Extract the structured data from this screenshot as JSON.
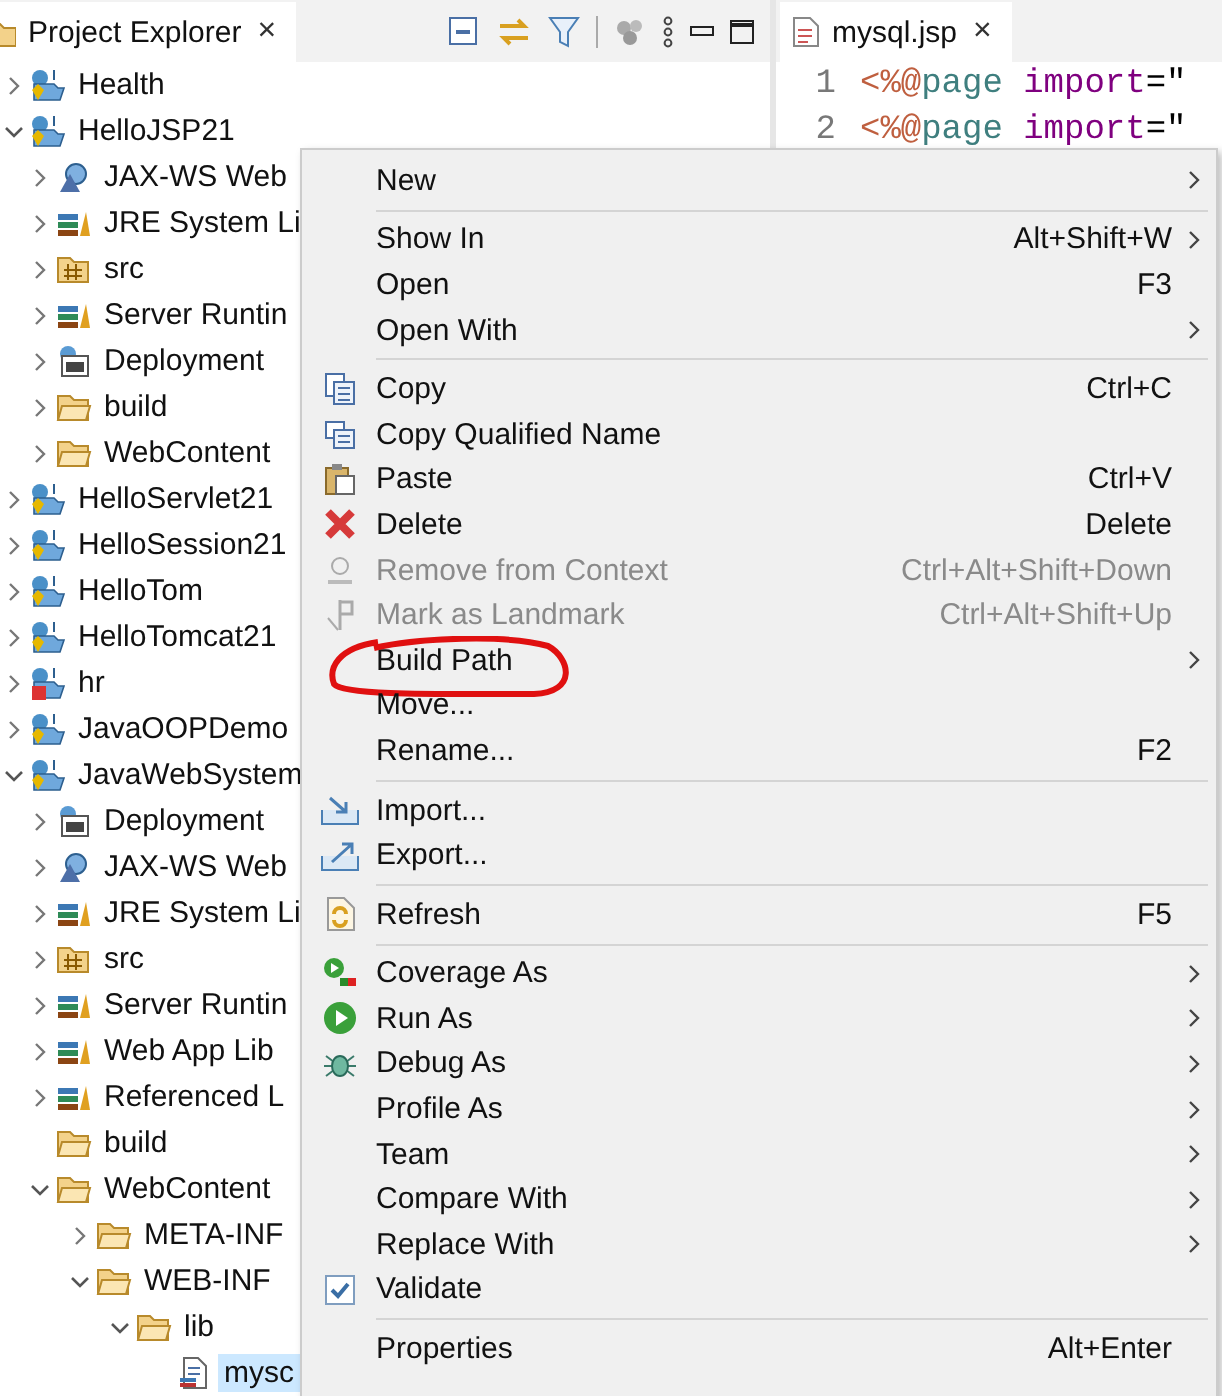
{
  "explorer": {
    "title": "Project Explorer",
    "close": "×"
  },
  "tree": [
    {
      "label": "Health",
      "kind": "project",
      "expanded": false
    },
    {
      "label": "HelloJSP21",
      "kind": "project",
      "expanded": true,
      "children": [
        {
          "label": "JAX-WS Web",
          "kind": "webservice",
          "expanded": false
        },
        {
          "label": "JRE System Li",
          "kind": "library",
          "expanded": false
        },
        {
          "label": "src",
          "kind": "source",
          "expanded": false
        },
        {
          "label": "Server Runtin",
          "kind": "library",
          "expanded": false
        },
        {
          "label": "Deployment",
          "kind": "deployment",
          "expanded": false
        },
        {
          "label": "build",
          "kind": "folder",
          "expanded": false
        },
        {
          "label": "WebContent",
          "kind": "folder",
          "expanded": false
        }
      ]
    },
    {
      "label": "HelloServlet21",
      "kind": "project",
      "expanded": false
    },
    {
      "label": "HelloSession21",
      "kind": "project",
      "expanded": false
    },
    {
      "label": "HelloTom",
      "kind": "project",
      "expanded": false
    },
    {
      "label": "HelloTomcat21",
      "kind": "project",
      "expanded": false
    },
    {
      "label": "hr",
      "kind": "project-error",
      "expanded": false
    },
    {
      "label": "JavaOOPDemo",
      "kind": "project",
      "expanded": false
    },
    {
      "label": "JavaWebSystem",
      "kind": "project",
      "expanded": true,
      "children": [
        {
          "label": "Deployment",
          "kind": "deployment",
          "expanded": false
        },
        {
          "label": "JAX-WS Web",
          "kind": "webservice",
          "expanded": false
        },
        {
          "label": "JRE System Li",
          "kind": "library",
          "expanded": false
        },
        {
          "label": "src",
          "kind": "source",
          "expanded": false
        },
        {
          "label": "Server Runtin",
          "kind": "library",
          "expanded": false
        },
        {
          "label": "Web App Lib",
          "kind": "library",
          "expanded": false
        },
        {
          "label": "Referenced L",
          "kind": "library",
          "expanded": false
        },
        {
          "label": "build",
          "kind": "folder"
        },
        {
          "label": "WebContent",
          "kind": "folder",
          "expanded": true,
          "children": [
            {
              "label": "META-INF",
              "kind": "folder",
              "expanded": false
            },
            {
              "label": "WEB-INF",
              "kind": "folder",
              "expanded": true,
              "children": [
                {
                  "label": "lib",
                  "kind": "folder",
                  "expanded": true,
                  "children": [
                    {
                      "label": "mysc",
                      "kind": "jar",
                      "selected": true
                    }
                  ]
                }
              ]
            }
          ]
        }
      ]
    }
  ],
  "editor": {
    "tab": "mysql.jsp",
    "close": "×",
    "lines": [
      {
        "number": "1",
        "tokens": [
          {
            "text": "<%@",
            "kind": "directive"
          },
          {
            "text": "page",
            "kind": "tag"
          },
          {
            "text": "import",
            "kind": "attribute"
          },
          {
            "text": "=\"",
            "kind": "plain"
          }
        ]
      },
      {
        "number": "2",
        "tokens": [
          {
            "text": "<%@",
            "kind": "directive"
          },
          {
            "text": "page",
            "kind": "tag"
          },
          {
            "text": "import",
            "kind": "attribute"
          },
          {
            "text": "=\"",
            "kind": "plain"
          }
        ]
      }
    ]
  },
  "menu": [
    {
      "kind": "item",
      "label": "New",
      "submenu": true
    },
    {
      "kind": "separator"
    },
    {
      "kind": "item",
      "label": "Show In",
      "shortcut": "Alt+Shift+W",
      "submenu": true
    },
    {
      "kind": "item",
      "label": "Open",
      "shortcut": "F3"
    },
    {
      "kind": "item",
      "label": "Open With",
      "submenu": true
    },
    {
      "kind": "separator"
    },
    {
      "kind": "copy",
      "label": "Copy",
      "shortcut": "Ctrl+C"
    },
    {
      "kind": "copyname",
      "label": "Copy Qualified Name"
    },
    {
      "kind": "paste",
      "label": "Paste",
      "shortcut": "Ctrl+V"
    },
    {
      "kind": "delete",
      "label": "Delete",
      "shortcut": "Delete"
    },
    {
      "kind": "remove",
      "label": "Remove from Context",
      "shortcut": "Ctrl+Alt+Shift+Down",
      "disabled": true
    },
    {
      "kind": "landmark",
      "label": "Mark as Landmark",
      "shortcut": "Ctrl+Alt+Shift+Up",
      "disabled": true
    },
    {
      "kind": "item",
      "label": "Build Path",
      "submenu": true,
      "circled": true
    },
    {
      "kind": "item",
      "label": "Move..."
    },
    {
      "kind": "item",
      "label": "Rename...",
      "shortcut": "F2"
    },
    {
      "kind": "separator"
    },
    {
      "kind": "import",
      "label": "Import..."
    },
    {
      "kind": "export",
      "label": "Export..."
    },
    {
      "kind": "separator"
    },
    {
      "kind": "refresh",
      "label": "Refresh",
      "shortcut": "F5"
    },
    {
      "kind": "separator"
    },
    {
      "kind": "coverage",
      "label": "Coverage As",
      "submenu": true
    },
    {
      "kind": "run",
      "label": "Run As",
      "submenu": true
    },
    {
      "kind": "debug",
      "label": "Debug As",
      "submenu": true
    },
    {
      "kind": "item",
      "label": "Profile As",
      "submenu": true
    },
    {
      "kind": "item",
      "label": "Team",
      "submenu": true
    },
    {
      "kind": "item",
      "label": "Compare With",
      "submenu": true
    },
    {
      "kind": "item",
      "label": "Replace With",
      "submenu": true
    },
    {
      "kind": "validate",
      "label": "Validate"
    },
    {
      "kind": "separator"
    },
    {
      "kind": "item",
      "label": "Properties",
      "shortcut": "Alt+Enter"
    }
  ]
}
